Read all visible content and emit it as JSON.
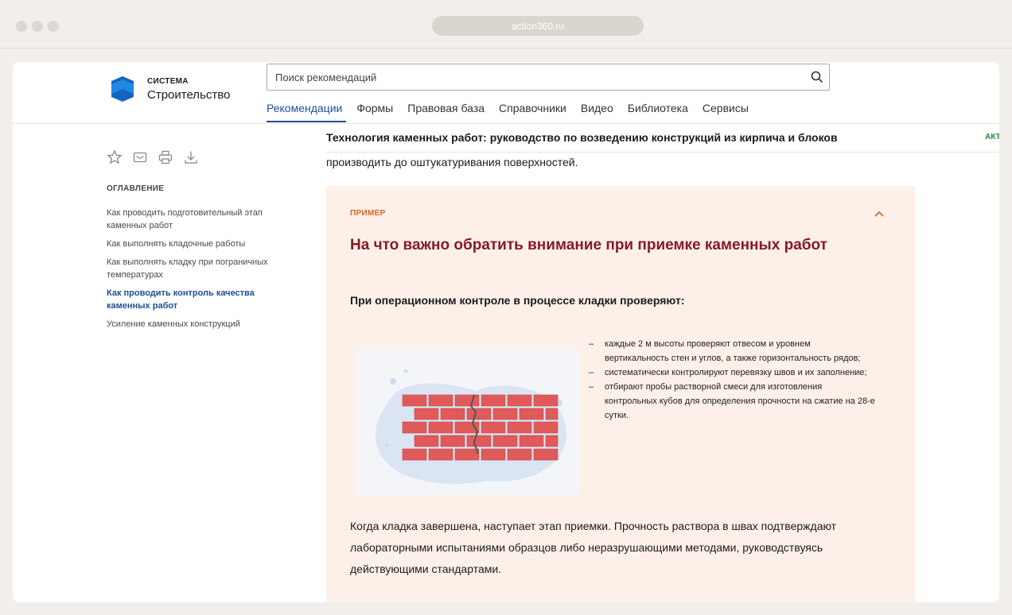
{
  "browser": {
    "url": "action360.ru"
  },
  "logo": {
    "small": "СИСТЕМА",
    "big": "Строительство"
  },
  "search": {
    "placeholder": "Поиск рекомендаций"
  },
  "nav": [
    "Рекомендации",
    "Формы",
    "Правовая база",
    "Справочники",
    "Видео",
    "Библиотека",
    "Сервисы"
  ],
  "doc": {
    "title": "Технология каменных работ: руководство по возведению конструкций из кирпича и блоков",
    "badge": "АКТ",
    "body_line": "производить до оштукатуривания поверхностей."
  },
  "toc": {
    "heading": "ОГЛАВЛЕНИЕ",
    "items": [
      "Как проводить подготовительный этап каменных работ",
      "Как выполнять кладочные работы",
      "Как выполнять кладку при пограничных температурах",
      "Как проводить контроль качества каменных работ",
      "Усиление каменных конструкций"
    ]
  },
  "example": {
    "label": "ПРИМЕР",
    "title": "На что важно обратить внимание при приемке каменных работ",
    "subtitle": "При операционном контроле в процессе кладки проверяют:",
    "bullets": [
      "каждые 2 м высоты проверяют отвесом и уровнем вертикальность стен и углов, а также горизонтальность рядов;",
      "систематически контролируют перевязку швов и их заполнение;",
      "отбирают пробы растворной смеси для изготовления контрольных кубов для определения прочности на сжатие на 28-е сутки."
    ],
    "closing": "Когда кладка завершена, наступает этап приемки. Прочность раствора в швах подтверждают лабораторными испытаниями образцов либо неразрушающими методами, руководствуясь действующими стандартами."
  },
  "colors": {
    "accent": "#1d4f91",
    "example_bg": "#fdf0e9",
    "example_label": "#e0641e",
    "example_title": "#861a26",
    "brick": "#e05a5a"
  },
  "icons": [
    "star-icon",
    "mail-icon",
    "print-icon",
    "download-icon",
    "search-icon",
    "chevron-up-icon"
  ]
}
